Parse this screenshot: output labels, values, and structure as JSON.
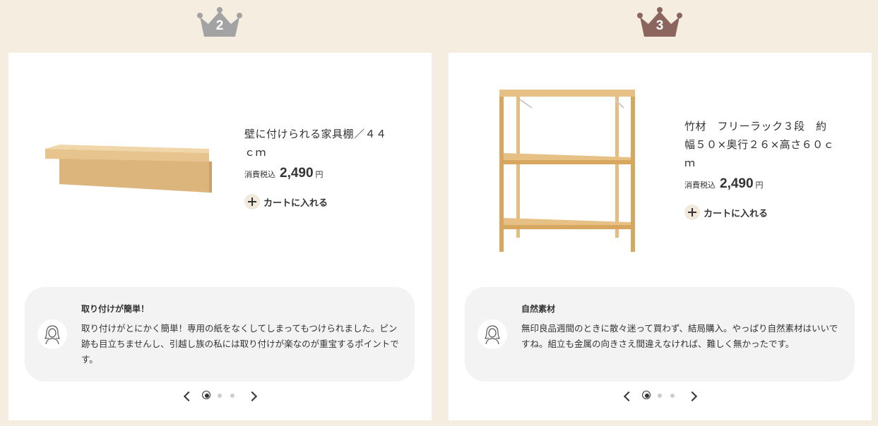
{
  "rankings": [
    {
      "rank": "2",
      "crown_color": "#a3a3a3",
      "product": {
        "title": "壁に付けられる家具棚／４４ｃｍ",
        "tax_label": "消費税込",
        "price": "2,490",
        "currency": "円",
        "cart_label": "カートに入れる"
      },
      "review": {
        "title": "取り付けが簡単！",
        "text": "取り付けがとにかく簡単！専用の紙をなくしてしまってもつけられました。ピン跡も目立ちませんし、引越し族の私には取り付けが楽なのが重宝するポイントです。"
      },
      "pager": {
        "total": 3,
        "current": 1
      }
    },
    {
      "rank": "3",
      "crown_color": "#8c665e",
      "product": {
        "title": "竹材　フリーラック３段　約幅５０×奥行２６×高さ６０ｃｍ",
        "tax_label": "消費税込",
        "price": "2,490",
        "currency": "円",
        "cart_label": "カートに入れる"
      },
      "review": {
        "title": "自然素材",
        "text": "無印良品週間のときに散々迷って買わず、結局購入。やっぱり自然素材はいいですね。組立も金属の向きさえ間違えなければ、難しく無かったです。"
      },
      "pager": {
        "total": 3,
        "current": 1
      }
    }
  ]
}
